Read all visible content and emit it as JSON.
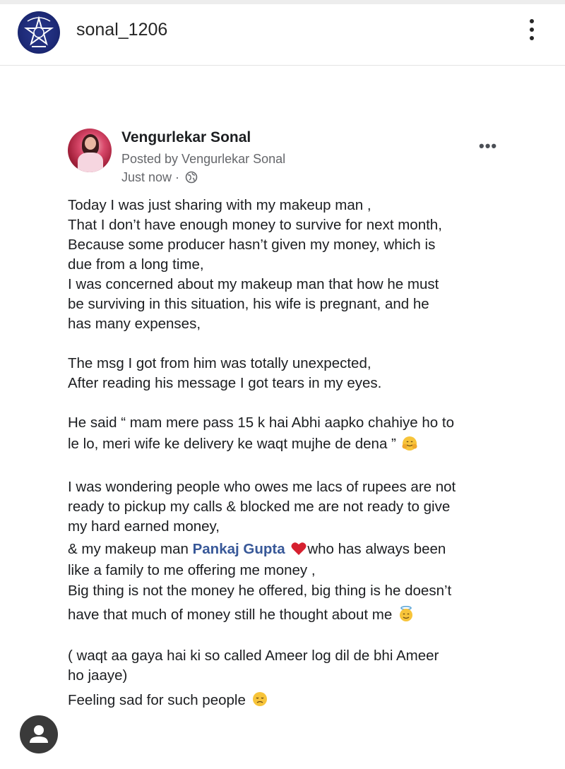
{
  "instagram": {
    "username": "sonal_1206",
    "avatar_icon": "police-emblem-icon",
    "more_icon": "vertical-ellipsis-icon"
  },
  "fb_post": {
    "author_name": "Vengurlekar Sonal",
    "posted_by": "Posted by Vengurlekar Sonal",
    "timestamp": "Just now ·",
    "privacy_icon": "globe-icon",
    "more_icon": "horizontal-ellipsis-icon",
    "mention": "Pankaj Gupta",
    "lines": [
      "Today I was just sharing with my makeup man ,",
      "That I don’t have enough money to survive for next month,",
      "Because some producer hasn’t given my money, which is",
      "due from a long time,",
      "I was concerned about my makeup man that how he must",
      "be surviving in this situation, his wife is pregnant, and he",
      "has many expenses,",
      "The msg I got from him was totally unexpected,",
      "After reading his message I got tears in my eyes.",
      "He said “ mam mere pass 15 k hai Abhi aapko chahiye ho to",
      "le lo, meri wife ke delivery ke waqt mujhe de dena ”",
      "I was wondering people who owes me lacs of rupees are not",
      "ready to pickup my calls & blocked me are not ready to give",
      "my hard earned money,",
      "& my makeup man ",
      "who has always been",
      "like a family to me offering me money ,",
      "Big thing is not the money he offered, big thing is he doesn’t",
      "have that much of money still he thought about me",
      "( waqt aa gaya hai ki so called Ameer  log dil de bhi Ameer",
      "ho jaaye)",
      "Feeling sad for such people"
    ],
    "emojis": [
      "hugging-face-emoji",
      "red-heart-emoji",
      "smiling-face-with-halo-emoji",
      "disappointed-face-emoji"
    ]
  },
  "bottom": {
    "user_icon": "user-profile-icon"
  }
}
